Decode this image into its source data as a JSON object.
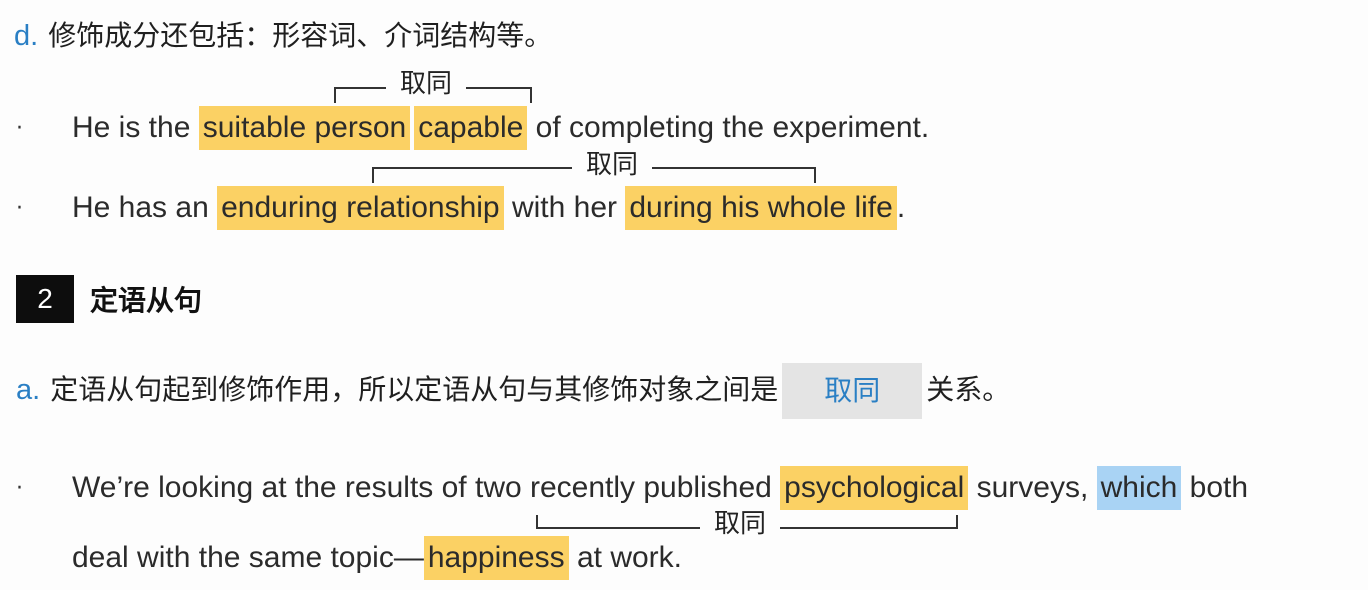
{
  "item_d": {
    "letter": "d.",
    "text": "修饰成分还包括：形容词、介词结构等。"
  },
  "examples_d": [
    {
      "bullet": "·",
      "prefix": "He is the ",
      "hl1": "suitable person",
      "hl2": "capable",
      "suffix": " of completing the experiment.",
      "annotation": "取同"
    },
    {
      "bullet": "·",
      "prefix": "He has an ",
      "hl1": "enduring relationship",
      "middle": " with her ",
      "hl2": "during his whole life",
      "suffix": ".",
      "annotation": "取同"
    }
  ],
  "section2": {
    "number": "2",
    "title": "定语从句"
  },
  "item_a": {
    "letter": "a.",
    "text_before": "定语从句起到修饰作用，所以定语从句与其修饰对象之间是",
    "answer": "取同",
    "text_after": "关系。"
  },
  "example_a": {
    "bullet": "·",
    "line1_prefix": "We’re looking at the results of two recently published ",
    "hl_yellow": "psychological",
    "line1_mid": " surveys, ",
    "hl_blue": "which",
    "line1_suffix": " both",
    "line2_prefix": "deal with the same topic—",
    "hl2": "happiness",
    "line2_suffix": " at work.",
    "annotation": "取同"
  },
  "colors": {
    "highlight_yellow": "#fbd164",
    "highlight_blue": "#a9d3f4",
    "letter_blue": "#2a7fc4",
    "answer_box_bg": "#e4e4e4"
  }
}
